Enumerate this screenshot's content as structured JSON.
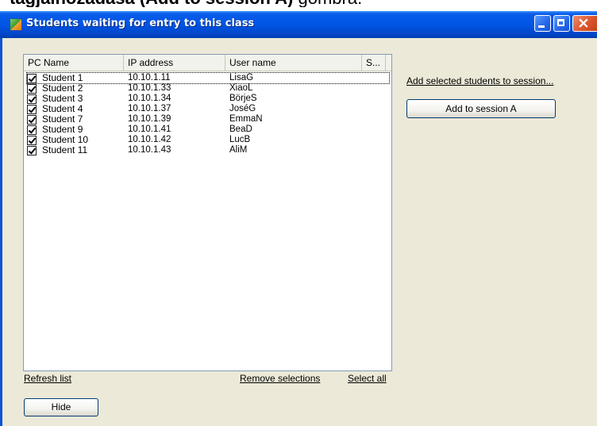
{
  "document_caption": {
    "bold_part": "tagjaihozadasa (Add to session A)",
    "normal_part": " gombra."
  },
  "window": {
    "title": "Students waiting for entry to this class",
    "icon": "app-icon",
    "controls": {
      "minimize": "minimize-icon",
      "maximize": "maximize-icon",
      "close": "close-icon",
      "close_glyph": "×"
    }
  },
  "list": {
    "columns": [
      "PC Name",
      "IP address",
      "User name",
      "S..."
    ],
    "rows": [
      {
        "pc": "Student 1",
        "ip": "10.10.1.11",
        "user": "LisaG",
        "checked": true
      },
      {
        "pc": "Student 2",
        "ip": "10.10.1.33",
        "user": "XiaoL",
        "checked": true
      },
      {
        "pc": "Student 3",
        "ip": "10.10.1.34",
        "user": "BörjeS",
        "checked": true
      },
      {
        "pc": "Student 4",
        "ip": "10.10.1.37",
        "user": "JoséG",
        "checked": true
      },
      {
        "pc": "Student 7",
        "ip": "10.10.1.39",
        "user": "EmmaN",
        "checked": true
      },
      {
        "pc": "Student 9",
        "ip": "10.10.1.41",
        "user": "BeaD",
        "checked": true
      },
      {
        "pc": "Student 10",
        "ip": "10.10.1.42",
        "user": "LucB",
        "checked": true
      },
      {
        "pc": "Student 11",
        "ip": "10.10.1.43",
        "user": "AliM",
        "checked": true
      }
    ]
  },
  "actions": {
    "add_selected_link": "Add selected students to session...",
    "add_to_session_button": "Add to session A",
    "refresh_link": "Refresh list",
    "remove_selections_link": "Remove selections",
    "select_all_link": "Select all",
    "hide_button": "Hide"
  }
}
